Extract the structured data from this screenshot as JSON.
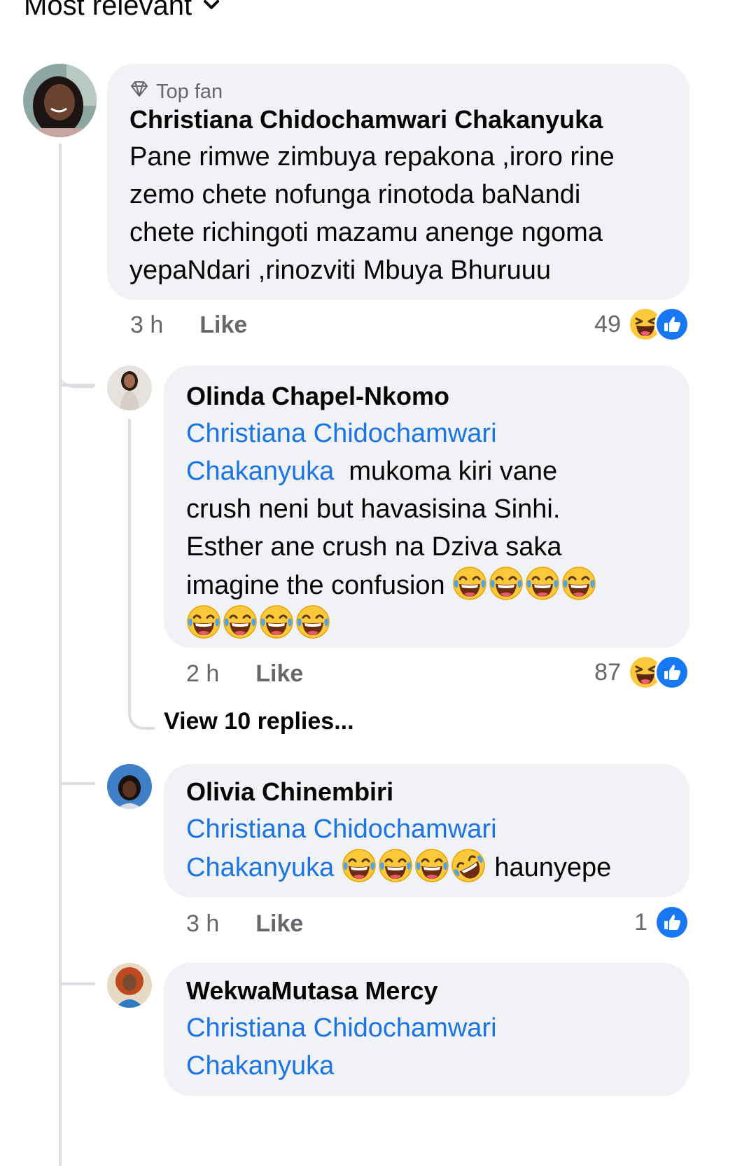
{
  "sort": {
    "label": "Most relevant"
  },
  "comments": [
    {
      "badge": "Top fan",
      "author": "Christiana Chidochamwari Chakanyuka",
      "text_lines": [
        "Pane rimwe zimbuya repakona ,iroro rine",
        "zemo chete nofunga rinotoda baNandi",
        "chete richingoti mazamu anenge ngoma",
        "yepaNdari ,rinozviti Mbuya Bhuruuu"
      ],
      "time": "3 h",
      "like_label": "Like",
      "reaction_count": "49",
      "reactions": [
        "haha-icon",
        "like-icon"
      ]
    }
  ],
  "replies": [
    {
      "author": "Olinda Chapel-Nkomo",
      "mention_line1": "Christiana Chidochamwari",
      "mention_line2": "Chakanyuka",
      "text_after_mention": "mukoma kiri vane",
      "text_lines": [
        "crush neni but havasisina Sinhi.",
        "Esther ane crush na Dziva saka",
        "imagine the confusion"
      ],
      "time": "2 h",
      "like_label": "Like",
      "reaction_count": "87",
      "reactions": [
        "haha-icon",
        "like-icon"
      ],
      "view_replies": "View 10 replies..."
    },
    {
      "author": "Olivia Chinembiri",
      "mention_line1": "Christiana Chidochamwari",
      "mention_line2": "Chakanyuka",
      "text_after_emoji": "haunyepe",
      "time": "3 h",
      "like_label": "Like",
      "reaction_count": "1",
      "reactions": [
        "like-icon"
      ]
    },
    {
      "author": "WekwaMutasa Mercy",
      "mention_line1": "Christiana Chidochamwari",
      "mention_line2": "Chakanyuka"
    }
  ],
  "colors": {
    "bubble": "#f0f2f5",
    "mention": "#1b74e4",
    "like_blue": "#1877f2",
    "haha_yellow": "#fcc93e",
    "secondary_text": "#65676b"
  }
}
